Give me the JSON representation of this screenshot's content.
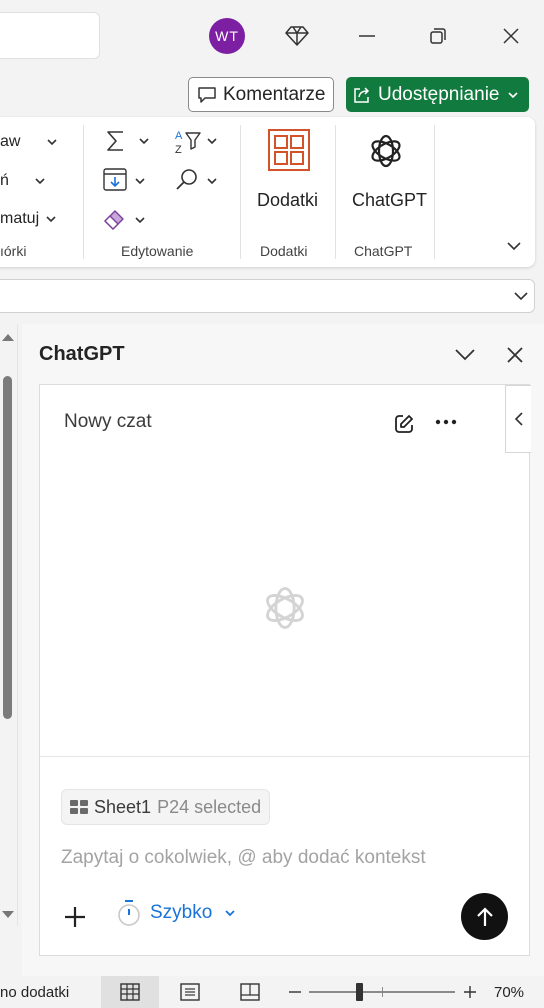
{
  "titlebar": {
    "avatar_initials": "WT",
    "avatar_color": "#7d1fa3",
    "icons": [
      "diamond-icon",
      "minimize-icon",
      "restore-icon",
      "close-icon"
    ]
  },
  "commandbar": {
    "comments_label": "Komentarze",
    "share_label": "Udostępnianie",
    "share_color": "#117a3e"
  },
  "ribbon": {
    "cells_partial": {
      "row1": "aw",
      "row2": "ń",
      "row3": "matuj",
      "group_label": "ıórki"
    },
    "editing_group_label": "Edytowanie",
    "addins_button_label": "Dodatki",
    "addins_group_label": "Dodatki",
    "chatgpt_button_label": "ChatGPT",
    "chatgpt_group_label": "ChatGPT"
  },
  "pane": {
    "title": "ChatGPT",
    "chat_heading": "Nowy czat",
    "context_chip": {
      "sheet": "Sheet1",
      "selection": "P24 selected"
    },
    "input_placeholder": "Zapytaj o cokolwiek, @ aby dodać kontekst",
    "speed_label": "Szybko",
    "accent_color": "#1a73d9"
  },
  "statusbar": {
    "left_text": "no dodatki",
    "zoom_label": "70%",
    "zoom_level_percent": 70
  }
}
